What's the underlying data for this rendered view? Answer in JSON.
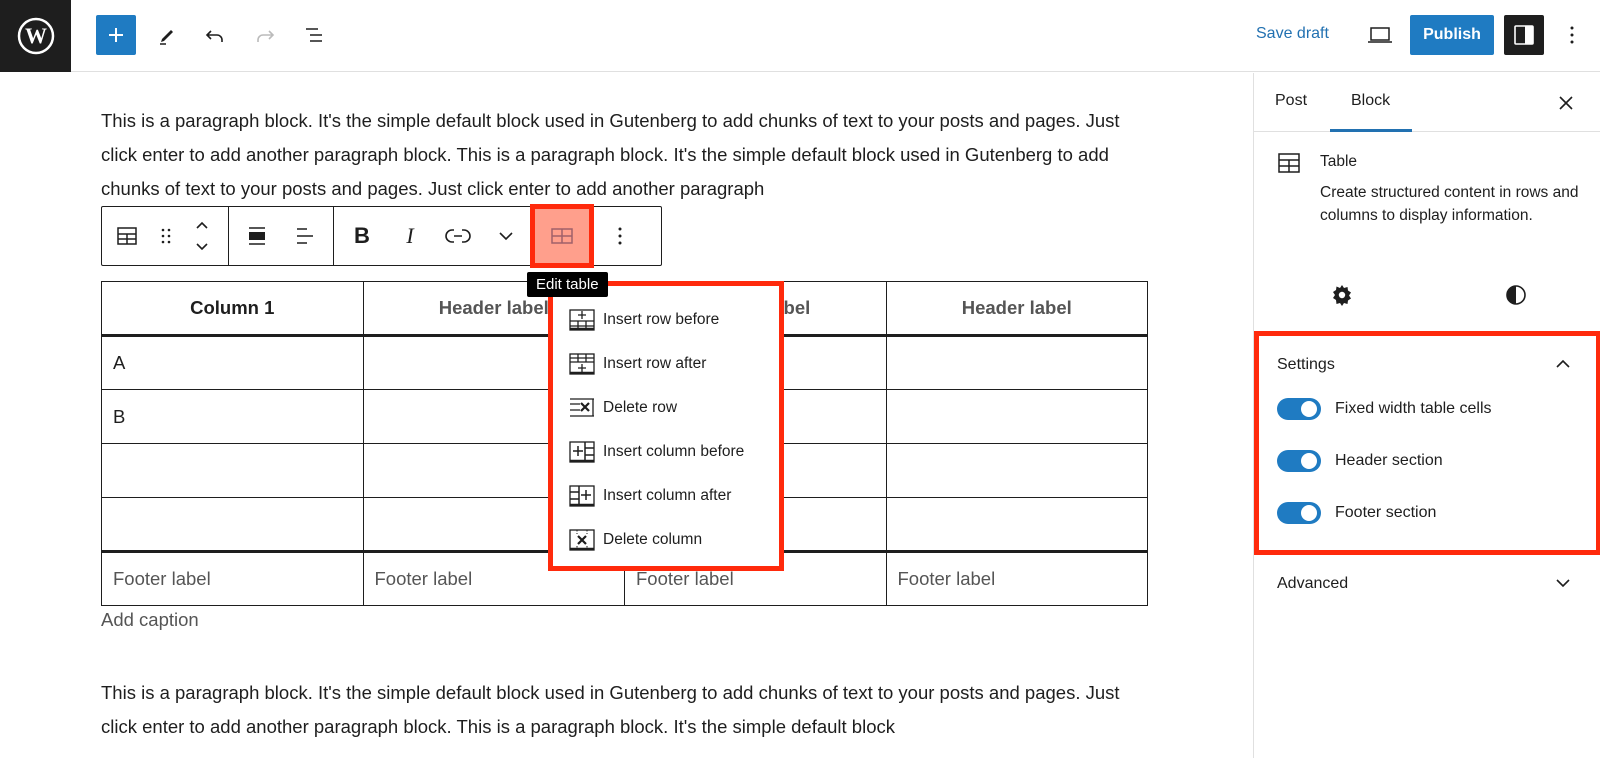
{
  "topbar": {
    "logo": "wordpress-logo",
    "icons": [
      "plus-icon",
      "pencil-icon",
      "undo-icon",
      "redo-icon",
      "list-view-icon"
    ],
    "save_draft": "Save draft",
    "preview_icon": "laptop-icon",
    "publish": "Publish",
    "settings_icon": "sidebar-icon",
    "more_icon": "kebab-icon"
  },
  "content": {
    "paragraph1": "This is a paragraph block. It's the simple default block used in Gutenberg to add chunks of text to your posts and pages. Just click enter to add another paragraph block. This is a paragraph block. It's the simple default block used in Gutenberg to add chunks of text to your posts and pages. Just click enter to add another paragraph",
    "paragraph2": "This is a paragraph block. It's the simple default block used in Gutenberg to add chunks of text to your posts and pages. Just click enter to add another paragraph block. This is a paragraph block. It's the simple default block",
    "caption_placeholder": "Add caption"
  },
  "block_toolbar": {
    "tooltip": "Edit table",
    "buttons": [
      "table-icon",
      "drag-handle-icon",
      "move-up-down-icon",
      "align-wide-icon",
      "align-text-icon",
      "bold-icon",
      "italic-icon",
      "link-icon",
      "chevron-down-icon",
      "edit-table-icon",
      "more-options-icon"
    ]
  },
  "table": {
    "headers": [
      "Column 1",
      "Header label",
      "Header label",
      "Header label"
    ],
    "rows": [
      [
        "A",
        "",
        "",
        ""
      ],
      [
        "B",
        "",
        "",
        ""
      ],
      [
        "",
        "",
        "",
        ""
      ],
      [
        "",
        "",
        "",
        ""
      ]
    ],
    "footer": [
      "Footer label",
      "Footer label",
      "Footer label",
      "Footer label"
    ]
  },
  "edit_menu": {
    "items": [
      {
        "label": "Insert row before",
        "icon": "table-row-before-icon"
      },
      {
        "label": "Insert row after",
        "icon": "table-row-after-icon"
      },
      {
        "label": "Delete row",
        "icon": "table-row-delete-icon"
      },
      {
        "label": "Insert column before",
        "icon": "table-column-before-icon"
      },
      {
        "label": "Insert column after",
        "icon": "table-column-after-icon"
      },
      {
        "label": "Delete column",
        "icon": "table-column-delete-icon"
      }
    ]
  },
  "sidebar": {
    "tabs": [
      "Post",
      "Block"
    ],
    "active_tab": "Block",
    "block": {
      "title": "Table",
      "description": "Create structured content in rows and columns to display information."
    },
    "settings": {
      "title": "Settings",
      "toggles": [
        {
          "label": "Fixed width table cells",
          "on": true
        },
        {
          "label": "Header section",
          "on": true
        },
        {
          "label": "Footer section",
          "on": true
        }
      ]
    },
    "advanced": {
      "title": "Advanced"
    }
  },
  "colors": {
    "accent": "#1f7bc2",
    "highlight": "#ff2a0c",
    "highlight_fill": "#ff9f8c"
  }
}
